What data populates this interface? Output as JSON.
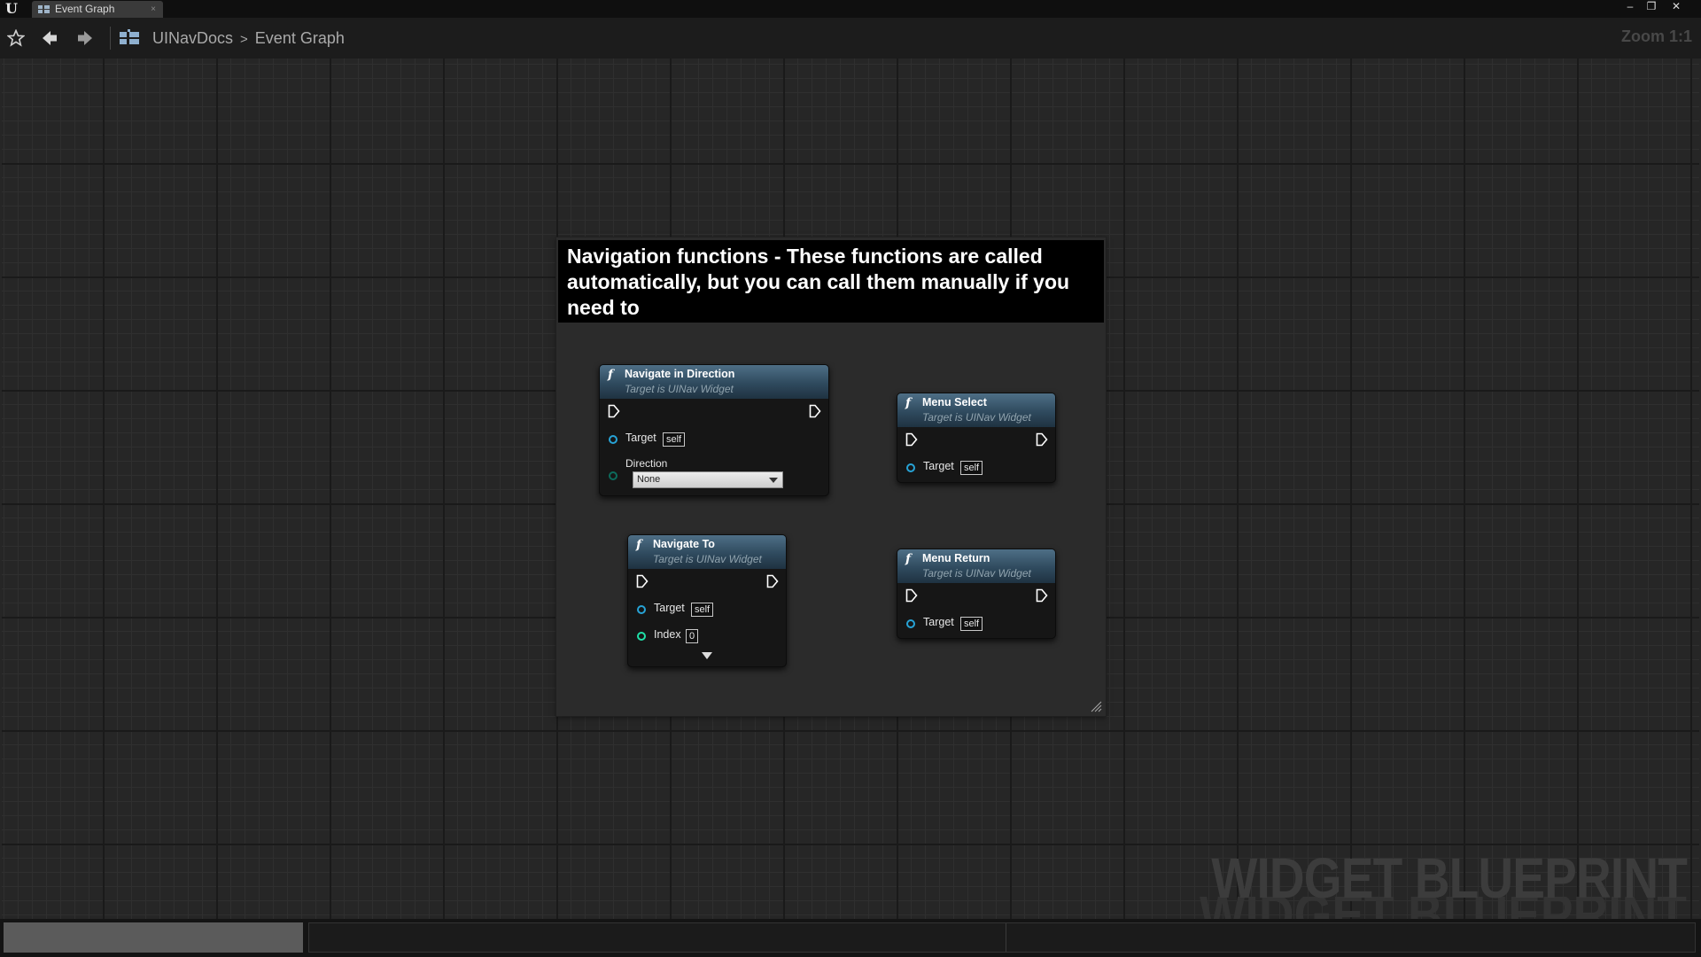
{
  "titlebar": {
    "tab_label": "Event Graph",
    "tab_close": "×",
    "minimize": "–",
    "restore": "❐",
    "close": "✕"
  },
  "toolbar": {
    "breadcrumb": [
      "UINavDocs",
      "Event Graph"
    ],
    "zoom": "Zoom 1:1"
  },
  "graph": {
    "comment": "Navigation functions - These functions are called automatically, but you can call them manually if you need to",
    "watermark": "WIDGET BLUEPRINT",
    "nodes": [
      {
        "title": "Navigate in Direction",
        "subtitle": "Target is UINav Widget",
        "pins": [
          {
            "label": "Target",
            "value": "self"
          },
          {
            "label": "Direction",
            "value": "None"
          }
        ]
      },
      {
        "title": "Menu Select",
        "subtitle": "Target is UINav Widget",
        "pins": [
          {
            "label": "Target",
            "value": "self"
          }
        ]
      },
      {
        "title": "Navigate To",
        "subtitle": "Target is UINav Widget",
        "pins": [
          {
            "label": "Target",
            "value": "self"
          },
          {
            "label": "Index",
            "value": "0"
          }
        ]
      },
      {
        "title": "Menu Return",
        "subtitle": "Target is UINav Widget",
        "pins": [
          {
            "label": "Target",
            "value": "self"
          }
        ]
      }
    ]
  },
  "colors": {
    "node_header": "#3f5d73",
    "object_pin": "#27a3d6",
    "int_pin": "#1fe0a8",
    "enum_pin": "#0c6b5c",
    "comment_bg": "#2b2b2b"
  },
  "icons": [
    "unreal-logo-icon",
    "blueprint-graph-icon",
    "star-icon",
    "back-arrow-icon",
    "forward-arrow-icon",
    "function-icon",
    "exec-pin-icon",
    "resize-grip-icon"
  ]
}
